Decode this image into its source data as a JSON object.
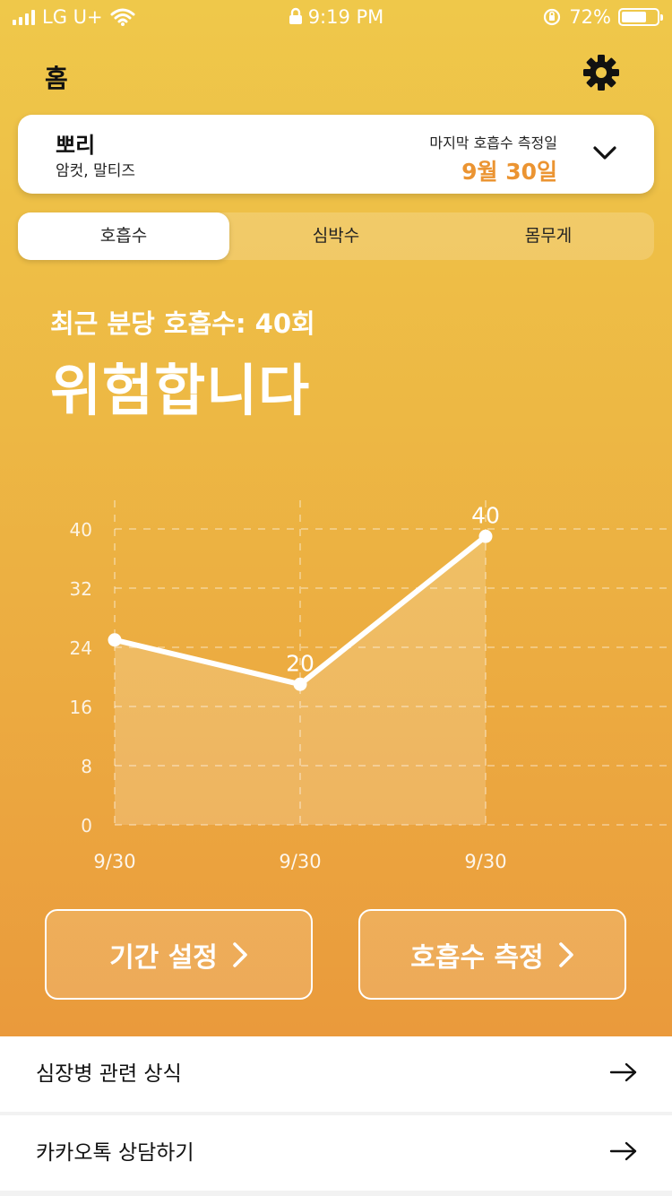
{
  "status_bar": {
    "carrier": "LG U+",
    "time": "9:19 PM",
    "battery": "72%",
    "battery_level": 0.72
  },
  "header": {
    "title": "홈",
    "settings_icon": "gear-icon"
  },
  "pet_card": {
    "name": "뽀리",
    "info": "암컷, 말티즈",
    "last_label": "마지막 호흡수 측정일",
    "last_date": "9월 30일"
  },
  "tabs": [
    {
      "label": "호흡수",
      "active": true
    },
    {
      "label": "심박수",
      "active": false
    },
    {
      "label": "몸무게",
      "active": false
    }
  ],
  "headline": {
    "subtitle": "최근 분당 호흡수: 40회",
    "status": "위험합니다"
  },
  "colors": {
    "accent": "#eb9432",
    "gradient_top": "#efc84a",
    "gradient_bottom": "#ea9a3c"
  },
  "chart_data": {
    "type": "area",
    "categories": [
      "9/30",
      "9/30",
      "9/30"
    ],
    "values": [
      25,
      19,
      39
    ],
    "data_labels": [
      "",
      "20",
      "40"
    ],
    "y_ticks": [
      "0",
      "8",
      "16",
      "24",
      "32",
      "40"
    ],
    "ylim": [
      0,
      40
    ],
    "grid": true
  },
  "buttons": {
    "period": "기간 설정",
    "measure": "호흡수 측정"
  },
  "list": [
    {
      "label": "심장병 관련 상식"
    },
    {
      "label": "카카오톡 상담하기"
    }
  ]
}
